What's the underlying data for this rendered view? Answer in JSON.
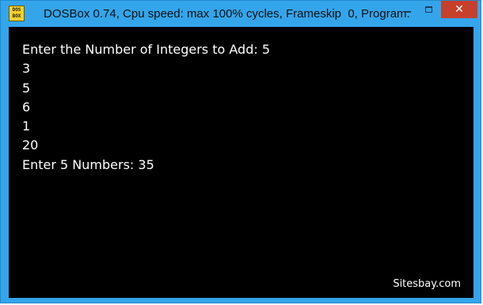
{
  "window": {
    "title": "DOSBox 0.74, Cpu speed: max 100% cycles, Frameskip  0, Program:",
    "app_icon": "dosbox-icon",
    "app_icon_text": [
      "DOS",
      "BOX"
    ],
    "controls": {
      "minimize_icon": "minimize-icon",
      "maximize_icon": "maximize-icon",
      "close_icon": "close-icon",
      "close_glyph": "✕"
    },
    "colors": {
      "frame": "#34a5eb",
      "close": "#c7402c",
      "console_bg": "#000000",
      "console_text": "#ffffff"
    }
  },
  "console": {
    "lines": [
      "Enter the Number of Integers to Add: 5",
      "3",
      "5",
      "6",
      "1",
      "20",
      "Enter 5 Numbers: 35"
    ],
    "watermark": "Sitesbay.com"
  }
}
